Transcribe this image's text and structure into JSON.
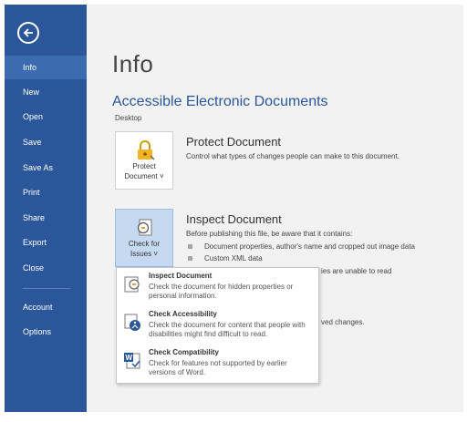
{
  "sidebar": {
    "items": [
      {
        "label": "Info",
        "active": true
      },
      {
        "label": "New"
      },
      {
        "label": "Open"
      },
      {
        "label": "Save"
      },
      {
        "label": "Save As"
      },
      {
        "label": "Print"
      },
      {
        "label": "Share"
      },
      {
        "label": "Export"
      },
      {
        "label": "Close"
      },
      {
        "label": "Account"
      },
      {
        "label": "Options"
      }
    ],
    "color": "#2b579a"
  },
  "main": {
    "title": "Info",
    "doc_title": "Accessible Electronic Documents",
    "doc_path": "Desktop",
    "protect": {
      "button_label_1": "Protect",
      "button_label_2": "Document ˅",
      "title": "Protect Document",
      "desc": "Control what types of changes people can make to this document."
    },
    "inspect": {
      "button_label_1": "Check for",
      "button_label_2": "Issues ˅",
      "title": "Inspect Document",
      "desc": "Before publishing this file, be aware that it contains:",
      "bullets": [
        "Document properties, author's name and cropped out image data",
        "Custom XML data"
      ],
      "partial_1": "ies are unable to read",
      "partial_2": "ved changes."
    }
  },
  "menu": {
    "items": [
      {
        "title": "Inspect Document",
        "desc": "Check the document for hidden properties or personal information.",
        "icon": "inspect-document-icon"
      },
      {
        "title": "Check Accessibility",
        "desc": "Check the document for content that people with disabilities might find difficult to read.",
        "icon": "accessibility-icon"
      },
      {
        "title": "Check Compatibility",
        "desc": "Check for features not supported by earlier versions of Word.",
        "icon": "compatibility-icon"
      }
    ]
  }
}
